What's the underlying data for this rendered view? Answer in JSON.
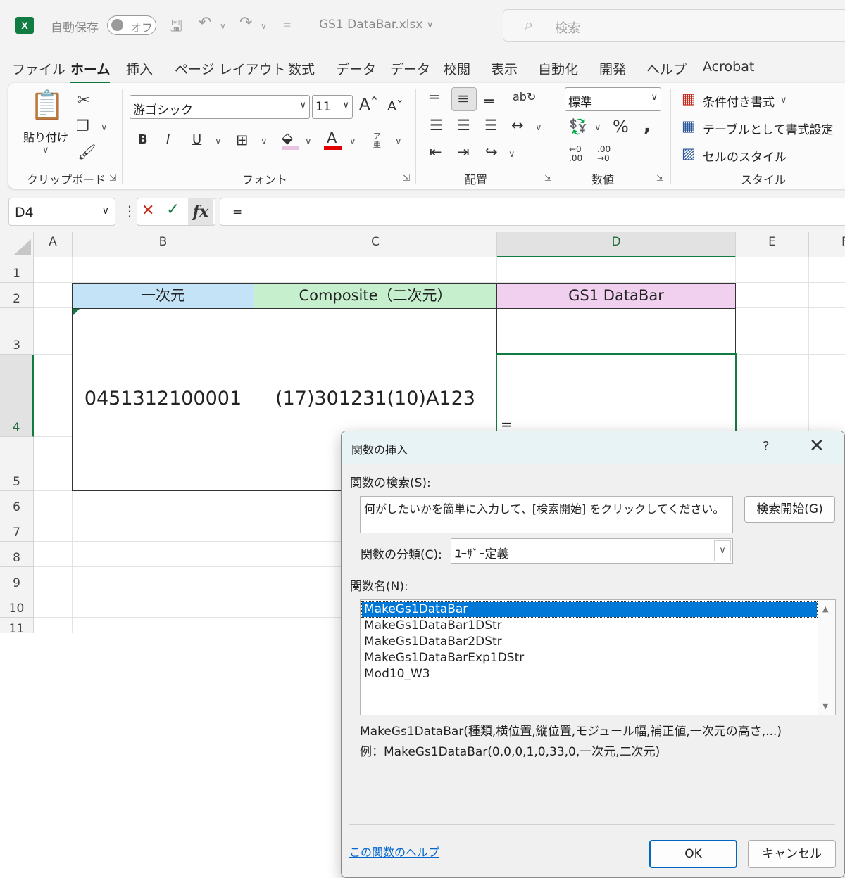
{
  "titlebar": {
    "autosave_label": "自動保存",
    "autosave_state": "オフ",
    "filename": "GS1 DataBar.xlsx",
    "search_placeholder": "検索"
  },
  "menu": [
    "ファイル",
    "ホーム",
    "挿入",
    "ページ レイアウト",
    "数式",
    "データ",
    "データ",
    "校閲",
    "表示",
    "自動化",
    "開発",
    "ヘルプ",
    "Acrobat"
  ],
  "menu_active": "ホーム",
  "ribbon": {
    "clipboard": {
      "paste_label": "貼り付け",
      "group_label": "クリップボード"
    },
    "font": {
      "font_name": "游ゴシック",
      "font_size": "11",
      "group_label": "フォント"
    },
    "alignment": {
      "group_label": "配置"
    },
    "number": {
      "format": "標準",
      "group_label": "数値"
    },
    "styles": {
      "conditional": "条件付き書式",
      "as_table": "テーブルとして書式設定",
      "cell_styles": "セルのスタイル",
      "group_label": "スタイル"
    }
  },
  "formula_bar": {
    "name_box": "D4",
    "formula": "="
  },
  "columns": [
    "A",
    "B",
    "C",
    "D",
    "E",
    "F"
  ],
  "rows": [
    "1",
    "2",
    "3",
    "4",
    "5",
    "6",
    "7",
    "8",
    "9",
    "10",
    "11"
  ],
  "cells": {
    "B2": "一次元",
    "C2": "Composite（二次元）",
    "D2": "GS1 DataBar",
    "B3": "0451312100001",
    "C3": "(17)301231(10)A123",
    "D4": "="
  },
  "colors": {
    "excel_green": "#107c41",
    "header_blue": "#c5e3f6",
    "header_green": "#c6efce",
    "header_pink": "#f0d0ee",
    "selection_blue": "#0078d7"
  },
  "dialog": {
    "title": "関数の挿入",
    "help_glyph": "?",
    "search_label": "関数の検索(S):",
    "search_text": "何がしたいかを簡単に入力して、[検索開始] をクリックしてください。",
    "search_button": "検索開始(G)",
    "category_label": "関数の分類(C):",
    "category_value": "ﾕｰｻﾞｰ定義",
    "names_label": "関数名(N):",
    "functions": [
      "MakeGs1DataBar",
      "MakeGs1DataBar1DStr",
      "MakeGs1DataBar2DStr",
      "MakeGs1DataBarExp1DStr",
      "Mod10_W3"
    ],
    "selected_function": "MakeGs1DataBar",
    "signature": "MakeGs1DataBar(種類,横位置,縦位置,モジュール幅,補正値,一次元の高さ,...)",
    "example": "例：MakeGs1DataBar(0,0,0,1,0,33,0,一次元,二次元)",
    "help_link": "この関数のヘルプ",
    "ok_button": "OK",
    "cancel_button": "キャンセル"
  }
}
